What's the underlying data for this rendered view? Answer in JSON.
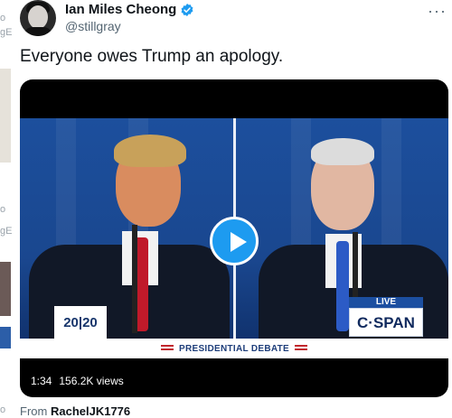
{
  "header": {
    "display_name": "Ian Miles Cheong",
    "handle": "@stillgray",
    "more_label": "···"
  },
  "tweet": {
    "text": "Everyone owes Trump an apology."
  },
  "media": {
    "logo_text": "20|20",
    "live_label": "LIVE",
    "network_label": "C·SPAN",
    "banner_text": "PRESIDENTIAL DEBATE",
    "duration": "1:34",
    "views": "156.2K views"
  },
  "attribution": {
    "prefix": "From",
    "source": "RachelJK1776"
  },
  "gutter": {
    "fragments": [
      "gE",
      "o",
      "gE",
      "o",
      "o"
    ]
  },
  "colors": {
    "accent": "#1d9bf0",
    "secondary_text": "#536471"
  },
  "icons": [
    "verified-badge-icon",
    "more-options-icon",
    "play-icon"
  ]
}
